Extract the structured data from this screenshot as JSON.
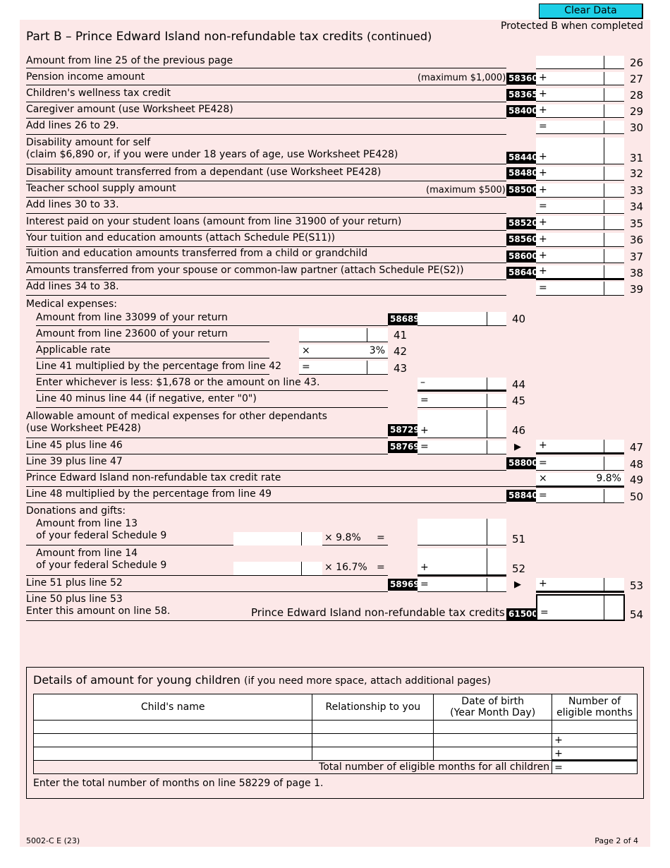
{
  "header": {
    "clear_button": "Clear Data",
    "protected": "Protected B when completed",
    "title": "Part B – Prince Edward Island non-refundable tax credits",
    "title_suffix": "(continued)"
  },
  "lines": {
    "l26": {
      "label": "Amount from line 25 of the previous page",
      "num": "26"
    },
    "l27": {
      "label": "Pension income amount",
      "note": "(maximum $1,000)",
      "code": "58360",
      "sign": "+",
      "num": "27"
    },
    "l28": {
      "label": "Children's wellness tax credit",
      "code": "58365",
      "sign": "+",
      "num": "28"
    },
    "l29": {
      "label": "Caregiver amount (use Worksheet PE428)",
      "code": "58400",
      "sign": "+",
      "num": "29"
    },
    "l30": {
      "label": "Add lines 26 to 29.",
      "sign": "=",
      "num": "30"
    },
    "l31": {
      "label": "Disability amount for self",
      "label2": "(claim $6,890 or, if you were under 18 years of age, use Worksheet PE428)",
      "code": "58440",
      "sign": "+",
      "num": "31"
    },
    "l32": {
      "label": "Disability amount transferred from a dependant (use Worksheet PE428)",
      "code": "58480",
      "sign": "+",
      "num": "32"
    },
    "l33": {
      "label": "Teacher school supply amount",
      "note": "(maximum $500)",
      "code": "58500",
      "sign": "+",
      "num": "33"
    },
    "l34": {
      "label": "Add lines 30 to 33.",
      "sign": "=",
      "num": "34"
    },
    "l35": {
      "label": "Interest paid on your student loans (amount from line 31900 of your return)",
      "code": "58520",
      "sign": "+",
      "num": "35"
    },
    "l36": {
      "label": "Your tuition and education amounts (attach Schedule PE(S11))",
      "code": "58560",
      "sign": "+",
      "num": "36"
    },
    "l37": {
      "label": "Tuition and education amounts transferred from a child or grandchild",
      "code": "58600",
      "sign": "+",
      "num": "37"
    },
    "l38": {
      "label": "Amounts transferred from your spouse or common-law partner (attach Schedule PE(S2))",
      "code": "58640",
      "sign": "+",
      "num": "38"
    },
    "l39": {
      "label": "Add lines 34 to 38.",
      "sign": "=",
      "num": "39"
    },
    "medical_heading": "Medical expenses:",
    "l40": {
      "label": "Amount from line 33099 of your return",
      "code": "58689",
      "num": "40"
    },
    "l41": {
      "label": "Amount from line 23600 of your return",
      "num": "41"
    },
    "l42": {
      "label": "Applicable rate",
      "sign": "×",
      "value": "3%",
      "num": "42"
    },
    "l43": {
      "label": "Line 41 multiplied by the percentage from line 42",
      "sign": "=",
      "num": "43"
    },
    "l44": {
      "label": "Enter whichever is less: $1,678 or the amount on line 43.",
      "sign": "–",
      "num": "44"
    },
    "l45": {
      "label": "Line 40 minus line 44 (if negative, enter \"0\")",
      "sign": "=",
      "num": "45"
    },
    "l46": {
      "label": "Allowable amount of medical expenses for other dependants",
      "label2": "(use Worksheet PE428)",
      "code": "58729",
      "sign": "+",
      "num": "46"
    },
    "l47": {
      "label": "Line 45 plus line 46",
      "code": "58769",
      "sign": "=",
      "arrow": "▶",
      "sign2": "+",
      "num": "47"
    },
    "l48": {
      "label": "Line 39 plus line 47",
      "code": "58800",
      "sign": "=",
      "num": "48"
    },
    "l49": {
      "label": "Prince Edward Island non-refundable tax credit rate",
      "sign": "×",
      "value": "9.8%",
      "num": "49"
    },
    "l50": {
      "label": "Line 48 multiplied by the percentage from line 49",
      "code": "58840",
      "sign": "=",
      "num": "50"
    },
    "donations_heading": "Donations and gifts:",
    "l51": {
      "label": "Amount from line 13",
      "label2": "of your federal Schedule 9",
      "rate": "×   9.8%",
      "eq": "=",
      "num": "51"
    },
    "l52": {
      "label": "Amount from line 14",
      "label2": "of your federal Schedule 9",
      "rate": "×  16.7%",
      "eq": "=",
      "sign": "+",
      "num": "52"
    },
    "l53": {
      "label": "Line 51 plus line 52",
      "code": "58969",
      "sign": "=",
      "arrow": "▶",
      "sign2": "+",
      "num": "53"
    },
    "l54": {
      "label": "Line 50 plus line 53",
      "label2": "Enter this amount on line 58.",
      "total_label": "Prince Edward Island non-refundable tax credits",
      "code": "61500",
      "sign": "=",
      "num": "54"
    }
  },
  "young_children": {
    "title": "Details of amount for young children",
    "title_note": "(if you need more space, attach additional pages)",
    "columns": [
      "Child's name",
      "Relationship to you",
      "Date of birth",
      "(Year Month Day)",
      "Number of",
      "eligible months"
    ],
    "rows": [
      {
        "name": "",
        "relationship": "",
        "dob": "",
        "months_sign": ""
      },
      {
        "name": "",
        "relationship": "",
        "dob": "",
        "months_sign": "+"
      },
      {
        "name": "",
        "relationship": "",
        "dob": "",
        "months_sign": "+"
      }
    ],
    "total_label": "Total number of eligible months for all children",
    "total_sign": "=",
    "note": "Enter the total number of months on line 58229 of page 1."
  },
  "footer": {
    "form_id": "5002-C E (23)",
    "page": "Page 2 of 4"
  }
}
